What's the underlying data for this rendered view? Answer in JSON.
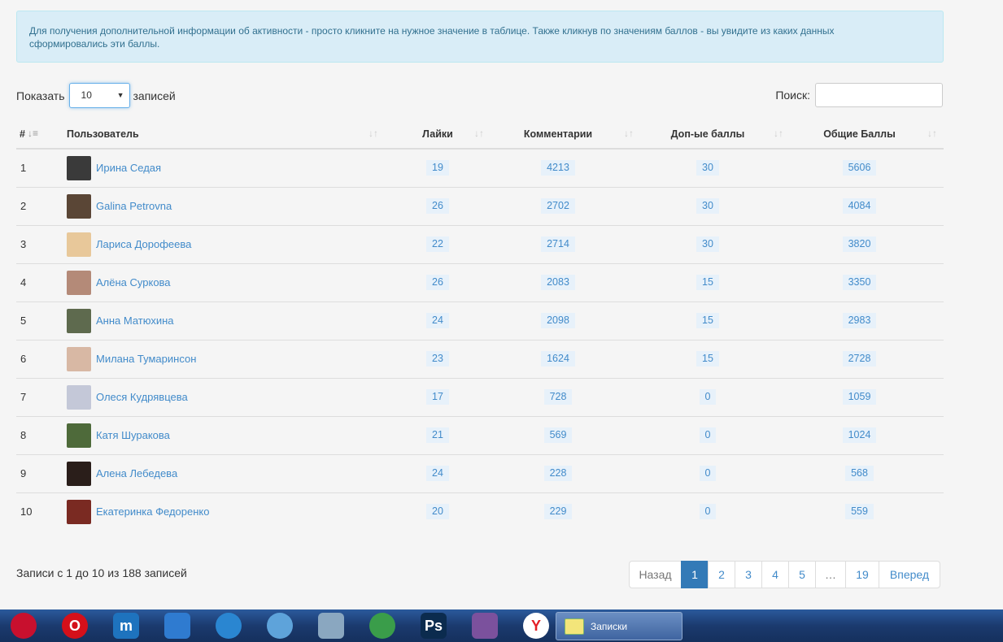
{
  "alert": {
    "line1": "Для получения дополнительной информации об активности - просто кликните на нужное значение в таблице. Также кликнув по значениям баллов - вы увидите из каких данных",
    "line2": "сформировались эти баллы."
  },
  "length": {
    "prefix": "Показать",
    "value": "10",
    "suffix": "записей"
  },
  "search": {
    "label": "Поиск:"
  },
  "table": {
    "headers": {
      "num": "#",
      "user": "Пользователь",
      "likes": "Лайки",
      "comments": "Комментарии",
      "bonus": "Доп-ые баллы",
      "total": "Общие Баллы"
    },
    "rows": [
      {
        "n": "1",
        "name": "Ирина Седая",
        "likes": "19",
        "comments": "4213",
        "bonus": "30",
        "total": "5606",
        "avatar_color": "#3a3a3a"
      },
      {
        "n": "2",
        "name": "Galina Petrovna",
        "likes": "26",
        "comments": "2702",
        "bonus": "30",
        "total": "4084",
        "avatar_color": "#5a4636"
      },
      {
        "n": "3",
        "name": "Лариса Дорофеева",
        "likes": "22",
        "comments": "2714",
        "bonus": "30",
        "total": "3820",
        "avatar_color": "#e8c89a"
      },
      {
        "n": "4",
        "name": "Алёна Суркова",
        "likes": "26",
        "comments": "2083",
        "bonus": "15",
        "total": "3350",
        "avatar_color": "#b48a78"
      },
      {
        "n": "5",
        "name": "Анна Матюхина",
        "likes": "24",
        "comments": "2098",
        "bonus": "15",
        "total": "2983",
        "avatar_color": "#5e6a4e"
      },
      {
        "n": "6",
        "name": "Милана Тумаринсон",
        "likes": "23",
        "comments": "1624",
        "bonus": "15",
        "total": "2728",
        "avatar_color": "#d8b8a4"
      },
      {
        "n": "7",
        "name": "Олеся Кудрявцева",
        "likes": "17",
        "comments": "728",
        "bonus": "0",
        "total": "1059",
        "avatar_color": "#c4c8d8"
      },
      {
        "n": "8",
        "name": "Катя Шуракова",
        "likes": "21",
        "comments": "569",
        "bonus": "0",
        "total": "1024",
        "avatar_color": "#4e6a3a"
      },
      {
        "n": "9",
        "name": "Алена Лебедева",
        "likes": "24",
        "comments": "228",
        "bonus": "0",
        "total": "568",
        "avatar_color": "#2a1e1a"
      },
      {
        "n": "10",
        "name": "Екатеринка Федоренко",
        "likes": "20",
        "comments": "229",
        "bonus": "0",
        "total": "559",
        "avatar_color": "#7a2a22"
      }
    ]
  },
  "info": "Записи с 1 до 10 из 188 записей",
  "pagination": [
    {
      "label": "Назад",
      "state": "disabled",
      "width": 65
    },
    {
      "label": "1",
      "state": "active",
      "width": 34
    },
    {
      "label": "2",
      "state": "normal",
      "width": 34
    },
    {
      "label": "3",
      "state": "normal",
      "width": 34
    },
    {
      "label": "4",
      "state": "normal",
      "width": 34
    },
    {
      "label": "5",
      "state": "normal",
      "width": 34
    },
    {
      "label": "…",
      "state": "disabled",
      "width": 38
    },
    {
      "label": "19",
      "state": "normal",
      "width": 42
    },
    {
      "label": "Вперед",
      "state": "normal",
      "width": 76
    }
  ],
  "taskbar": {
    "icons": [
      {
        "name": "start-app-icon",
        "color": "#c8102e",
        "glyph": ""
      },
      {
        "name": "opera-icon",
        "color": "#d4101a",
        "glyph": "O"
      },
      {
        "name": "maxthon-icon",
        "color": "#1e73be",
        "glyph": "m"
      },
      {
        "name": "swift-browser-icon",
        "color": "#2f7bd0",
        "glyph": ""
      },
      {
        "name": "globe-icon",
        "color": "#2a86d1",
        "glyph": ""
      },
      {
        "name": "safari-icon",
        "color": "#5ea3da",
        "glyph": ""
      },
      {
        "name": "calculator-icon",
        "color": "#8aa7c0",
        "glyph": ""
      },
      {
        "name": "chrome-icon",
        "color": "#3a9d4a",
        "glyph": ""
      },
      {
        "name": "photoshop-icon",
        "color": "#0b2b4e",
        "glyph": "Ps"
      },
      {
        "name": "viber-icon",
        "color": "#7b519d",
        "glyph": ""
      },
      {
        "name": "yandex-icon",
        "color": "#ffffff",
        "glyph": "Y"
      }
    ],
    "task_label": "Записки"
  }
}
